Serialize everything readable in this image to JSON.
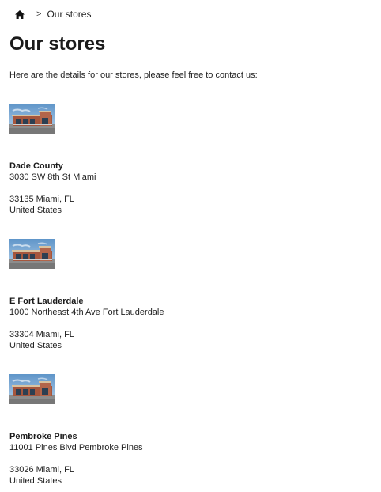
{
  "breadcrumb": {
    "home_icon": "home-icon",
    "separator": ">",
    "current": "Our stores"
  },
  "page": {
    "title": "Our stores",
    "intro": "Here are the details for our stores, please feel free to contact us:"
  },
  "stores": [
    {
      "name": "Dade County",
      "street": "3030 SW 8th St Miami",
      "city_line": "33135 Miami, FL",
      "country": "United States"
    },
    {
      "name": "E Fort Lauderdale",
      "street": "1000 Northeast 4th Ave Fort Lauderdale",
      "city_line": "33304 Miami, FL",
      "country": "United States"
    },
    {
      "name": "Pembroke Pines",
      "street": "11001 Pines Blvd Pembroke Pines",
      "city_line": "33026 Miami, FL",
      "country": "United States"
    }
  ]
}
